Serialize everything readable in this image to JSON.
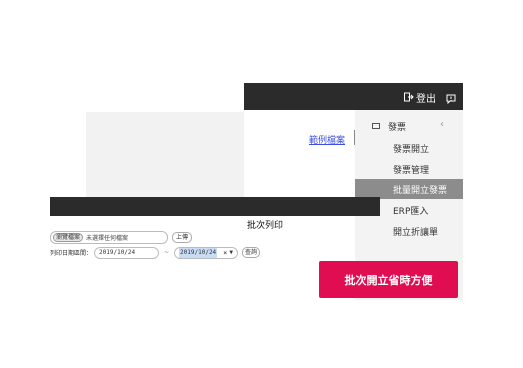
{
  "header": {
    "logout_label": "登出"
  },
  "sidebar": {
    "parent_label": "發票",
    "items": [
      {
        "label": "發票開立",
        "active": false
      },
      {
        "label": "發票管理",
        "active": false
      },
      {
        "label": "批量開立發票",
        "active": true
      },
      {
        "label": "ERP匯入",
        "active": false
      },
      {
        "label": "開立折讓單",
        "active": false
      }
    ]
  },
  "page": {
    "sample_file_link": "範例檔案"
  },
  "modal": {
    "title": "批次列印",
    "file": {
      "browse_label": "瀏覽檔案",
      "status_text": "未選擇任何檔案",
      "upload_label": "上傳"
    },
    "date_filter": {
      "label": "列印日期區間：",
      "start_date": "2019/10/24",
      "separator": "~",
      "end_date": "2019/10/24",
      "query_label": "查詢"
    }
  },
  "cta": {
    "label": "批次開立省時方便"
  },
  "colors": {
    "cta_bg": "#e10d52",
    "topbar_bg": "#2b2b2b",
    "link": "#3c4de0"
  }
}
